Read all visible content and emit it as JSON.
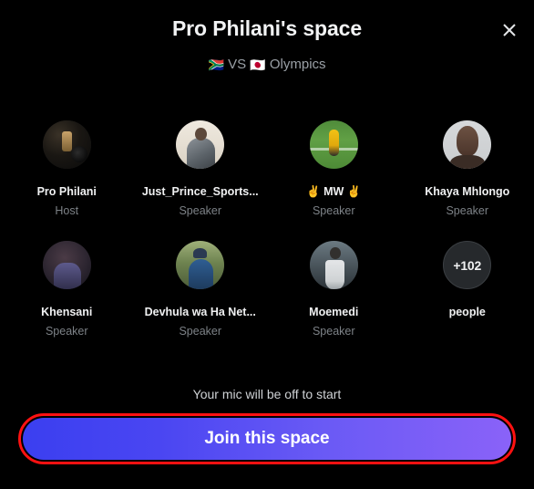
{
  "header": {
    "title": "Pro Philani's space",
    "subtitle_flag_left": "🇿🇦",
    "subtitle_vs": "VS",
    "subtitle_flag_right": "🇯🇵",
    "subtitle_text": "Olympics",
    "close_icon": "close-icon"
  },
  "participants": [
    {
      "name": "Pro Philani",
      "role": "Host",
      "avatar": "av-prophilani"
    },
    {
      "name": "Just_Prince_Sports...",
      "role": "Speaker",
      "avatar": "av-prince"
    },
    {
      "name": "✌ MW ✌",
      "role": "Speaker",
      "avatar": "av-mw"
    },
    {
      "name": "Khaya Mhlongo",
      "role": "Speaker",
      "avatar": "av-khaya"
    },
    {
      "name": "Khensani",
      "role": "Speaker",
      "avatar": "av-khensani"
    },
    {
      "name": "Devhula wa Ha Net...",
      "role": "Speaker",
      "avatar": "av-devhula"
    },
    {
      "name": "Moemedi",
      "role": "Speaker",
      "avatar": "av-moemedi"
    }
  ],
  "overflow": {
    "count_label": "+102",
    "caption": "people"
  },
  "footer": {
    "mic_note": "Your mic will be off to start",
    "join_label": "Join this space"
  },
  "colors": {
    "background": "#000000",
    "accent_blue": "#3b3ff0",
    "accent_purple": "#8a62f8",
    "highlight_ring": "#ff1111",
    "text_primary": "#f0f1f2",
    "text_muted": "#7d8287"
  }
}
